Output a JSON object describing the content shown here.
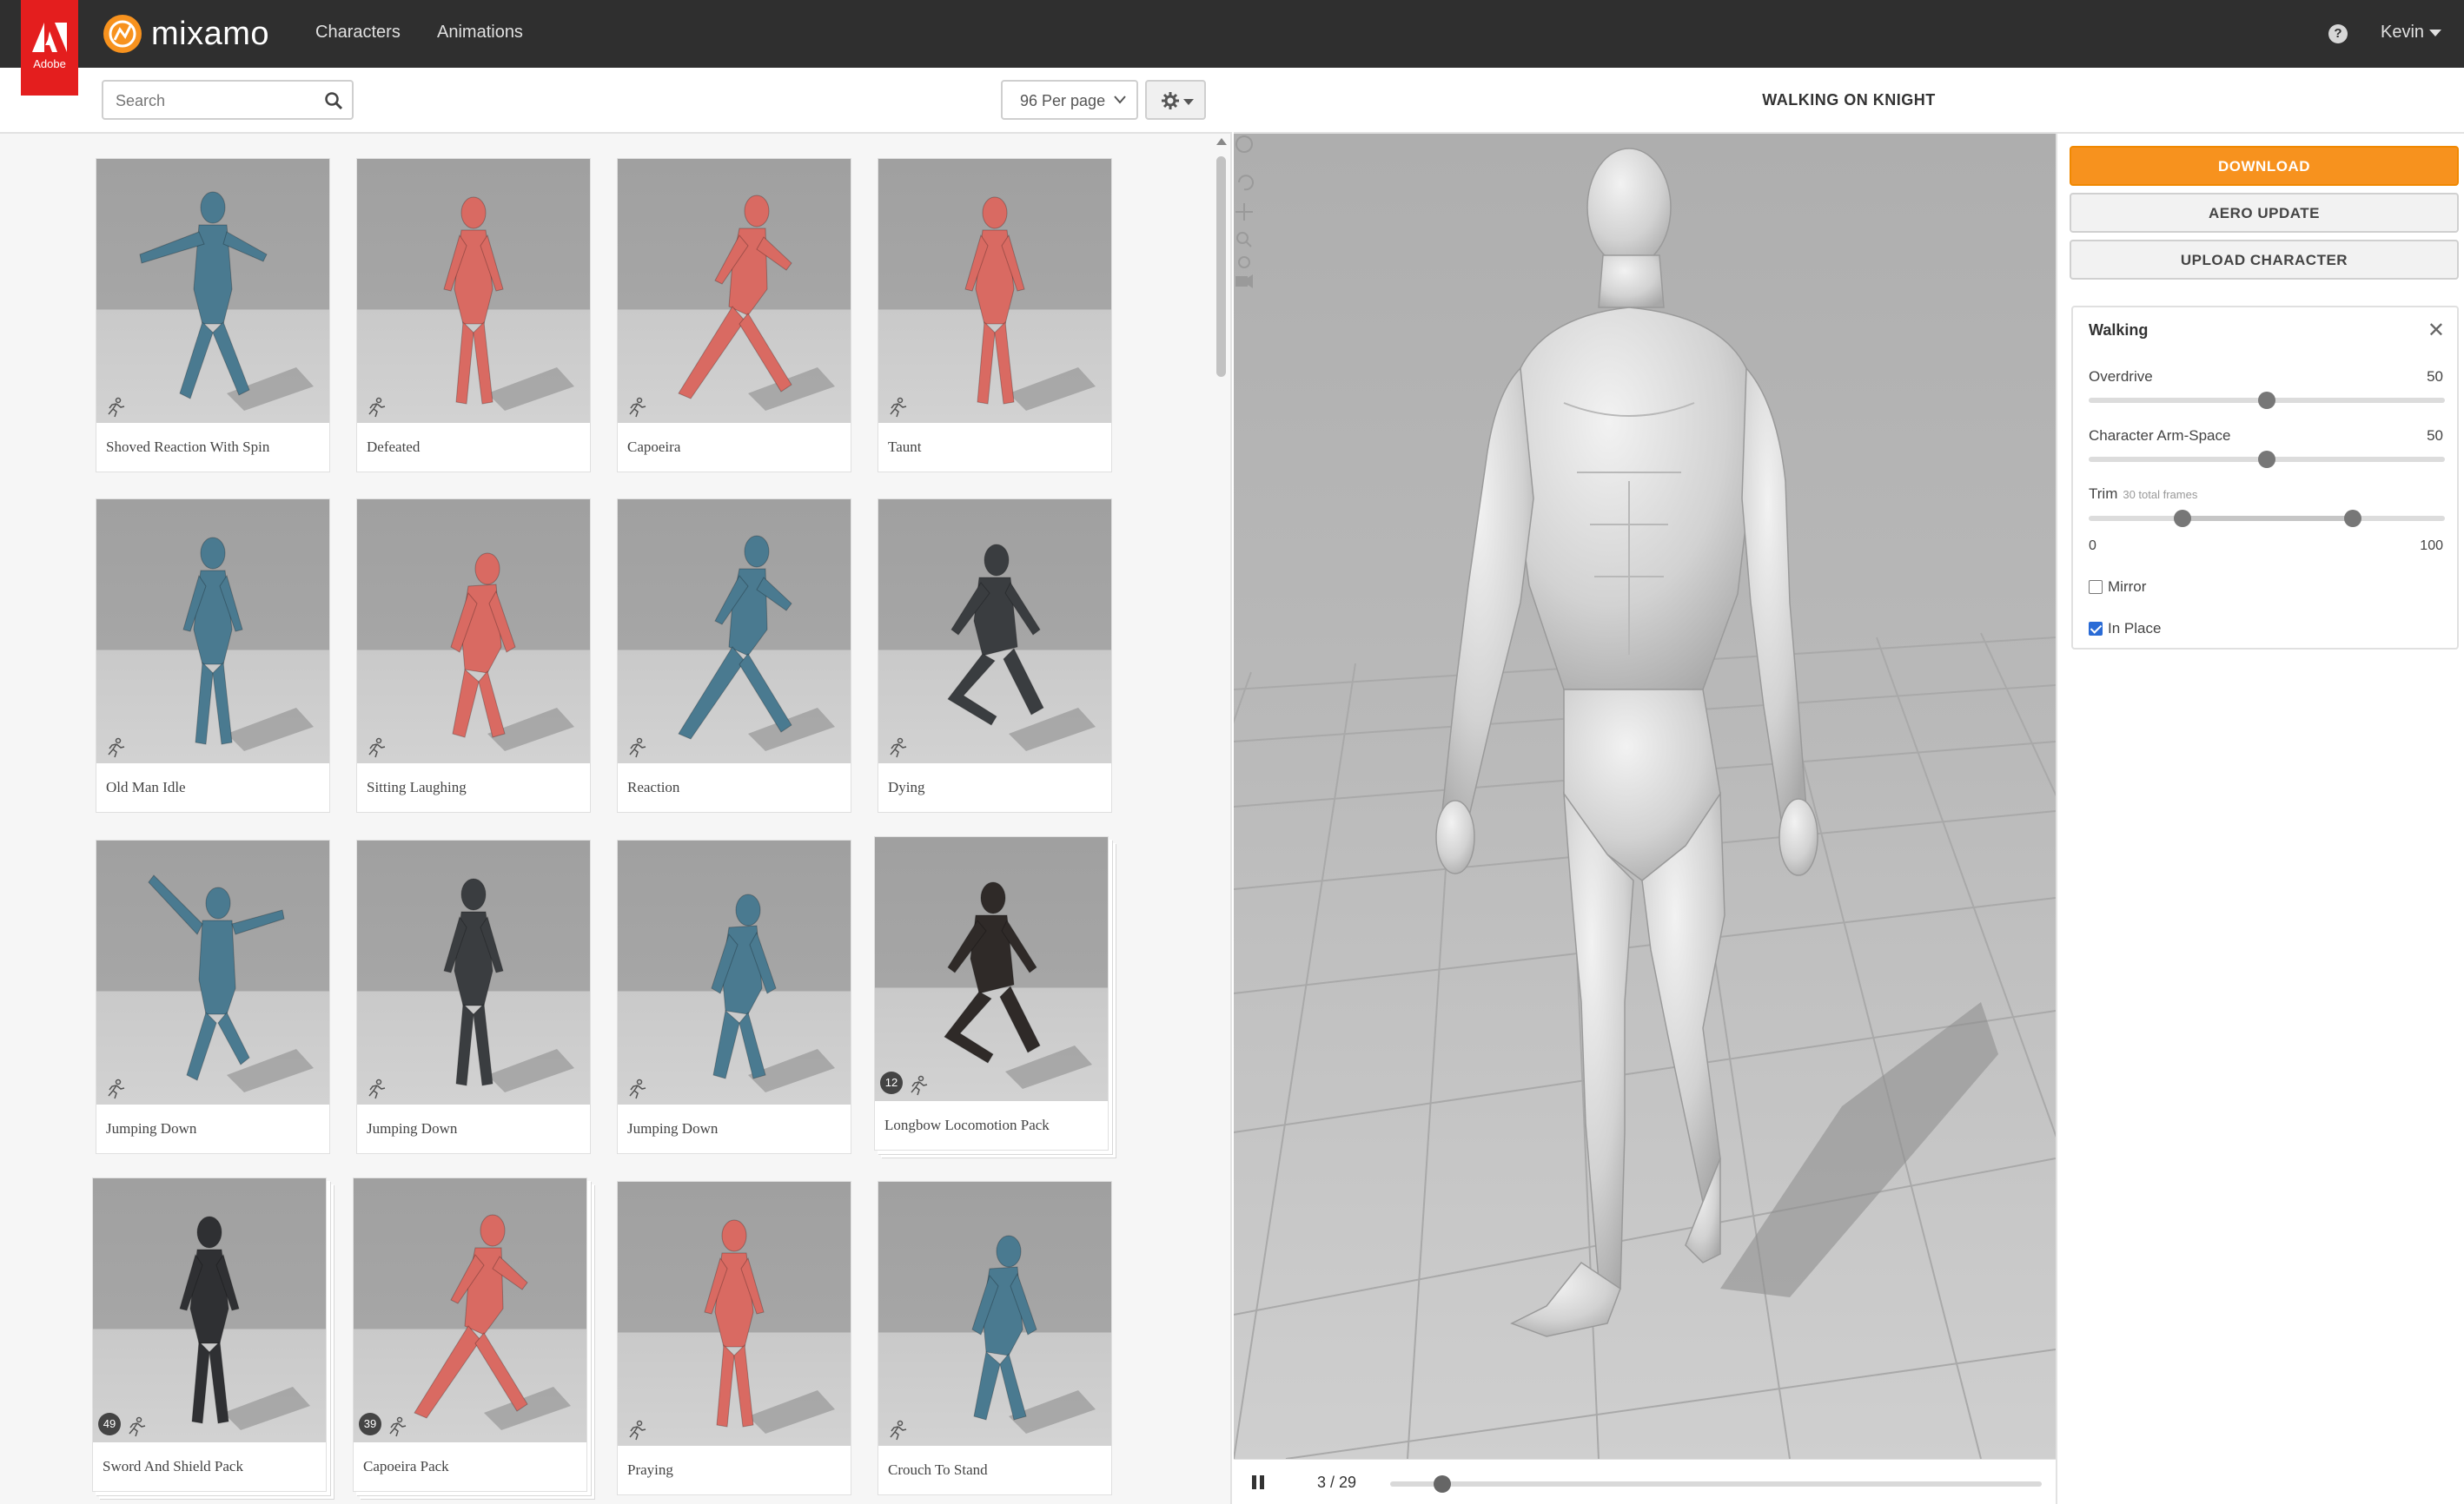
{
  "brand": {
    "adobe": "Adobe",
    "name": "mixamo"
  },
  "nav": {
    "characters": "Characters",
    "animations": "Animations",
    "user": "Kevin"
  },
  "toolbar": {
    "search_placeholder": "Search",
    "per_page": "96 Per page"
  },
  "cards": [
    {
      "label": "Shoved Reaction With Spin",
      "pack_count": null
    },
    {
      "label": "Defeated",
      "pack_count": null
    },
    {
      "label": "Capoeira",
      "pack_count": null
    },
    {
      "label": "Taunt",
      "pack_count": null
    },
    {
      "label": "Old Man Idle",
      "pack_count": null
    },
    {
      "label": "Sitting Laughing",
      "pack_count": null
    },
    {
      "label": "Reaction",
      "pack_count": null
    },
    {
      "label": "Dying",
      "pack_count": null
    },
    {
      "label": "Jumping Down",
      "pack_count": null
    },
    {
      "label": "Jumping Down",
      "pack_count": null
    },
    {
      "label": "Jumping Down",
      "pack_count": null
    },
    {
      "label": "Longbow Locomotion Pack",
      "pack_count": "12"
    },
    {
      "label": "Sword And Shield Pack",
      "pack_count": "49"
    },
    {
      "label": "Capoeira Pack",
      "pack_count": "39"
    },
    {
      "label": "Praying",
      "pack_count": null
    },
    {
      "label": "Crouch To Stand",
      "pack_count": null
    }
  ],
  "viewer": {
    "title": "WALKING ON KNIGHT",
    "frame": "3 / 29",
    "playhead_fraction": 0.08
  },
  "panel": {
    "download": "DOWNLOAD",
    "aero_update": "AERO UPDATE",
    "upload_character": "UPLOAD CHARACTER",
    "settings_title": "Walking",
    "overdrive_label": "Overdrive",
    "overdrive_value": "50",
    "arm_space_label": "Character Arm-Space",
    "arm_space_value": "50",
    "trim_label": "Trim",
    "trim_sub": "30 total frames",
    "trim_min": "0",
    "trim_max": "100",
    "mirror_label": "Mirror",
    "mirror_checked": false,
    "in_place_label": "In Place",
    "in_place_checked": true
  },
  "colors": {
    "accent": "#f7921e",
    "topbar": "#2f2f2f",
    "adobe_red": "#e41e1e",
    "mannequin_blue": "#4a7a90",
    "mannequin_red": "#d96a62",
    "soldier_dark": "#3a3d40"
  }
}
